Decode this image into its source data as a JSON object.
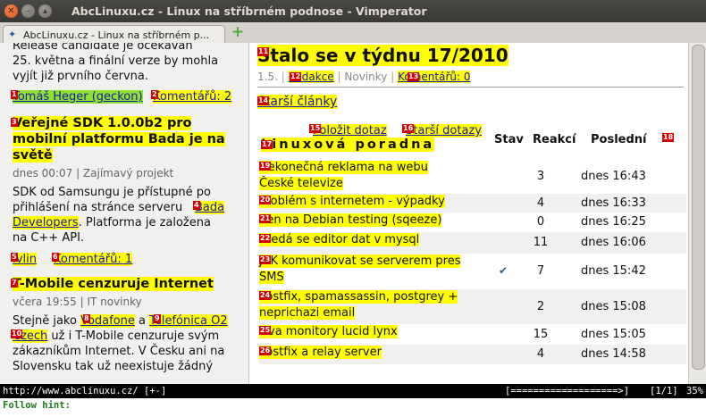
{
  "window": {
    "title": "AbcLinuxu.cz - Linux na stříbrném podnose - Vimperator"
  },
  "tab": {
    "title": "AbcLinuxu.cz - Linux na stříbrném p...",
    "favicon": "abclinuxu-favicon",
    "new_tab": "+"
  },
  "left": {
    "intro_lines": [
      "Release candidate je očekáván",
      "25. května a finální verze by mohla",
      "vyjít již prvního června."
    ],
    "item1": {
      "author_hint": "1",
      "author": "Tomáš Heger (geckon)",
      "comments_hint": "2",
      "comments": "Komentářů: 2"
    },
    "item2": {
      "hint": "3",
      "title_lines": [
        "Veřejné SDK 1.0.0b2 pro",
        "mobilní platformu Bada je na",
        "světě"
      ],
      "meta": "dnes 00:07 | Zajímavý projekt",
      "body1": "SDK od Samsungu je přístupné po",
      "body2": "přihlášení na stránce serveru",
      "link_hint": "4",
      "link_a": "Bada",
      "link_b": "Developers",
      "body3": ". Platforma je založena",
      "body4": "na C++ API.",
      "author_hint": "5",
      "author": "Ivlin",
      "comments_hint": "6",
      "comments": "Komentářů: 1"
    },
    "item3": {
      "hint": "7",
      "title": "T-Mobile cenzuruje Internet",
      "meta": "včera 19:55 | IT novinky",
      "body1a": "Stejně jako ",
      "vodafone_hint": "8",
      "vodafone": "Vodafone",
      "body1b": " a ",
      "tel_hint": "9",
      "tel_a": "Telefónica O2",
      "tel_hint2": "10",
      "tel_b": "Czech",
      "body2b": " už i T-Mobile cenzuruje svým",
      "body3": "zákazníkům Internet. V Česku ani na",
      "body4": "Slovensku tak už neexistuje žádný"
    }
  },
  "right": {
    "title_hint": "11",
    "title": "Stalo se v týdnu 17/2010",
    "meta_date": "1.5.",
    "meta_redakce_hint": "12",
    "meta_redakce": "Redakce",
    "meta_cat": "Novinky",
    "meta_comments_hint": "13",
    "meta_comments": "Komentářů: 0",
    "older_hint": "14",
    "older": "Starší články",
    "ask_hint": "15",
    "ask": "Položit dotaz",
    "older_q_hint": "16",
    "older_q": "Starší dotazy",
    "forum_hint": "17",
    "forum": "Linuxová poradna",
    "col_stav": "Stav",
    "col_reakci": "Reakcí",
    "col_posledni": "Poslední",
    "col_hint": "18",
    "questions": [
      {
        "hint": "19",
        "lines": [
          "Nekonečná reklama na webu",
          "České televize"
        ],
        "replies": "3",
        "last": "dnes 16:43",
        "stav": ""
      },
      {
        "hint": "20",
        "lines": [
          "Problém s internetem - výpadky"
        ],
        "replies": "4",
        "last": "dnes 16:33",
        "stav": ""
      },
      {
        "hint": "21",
        "lines": [
          "Xen na Debian testing (sqeeze)"
        ],
        "replies": "0",
        "last": "dnes 16:25",
        "stav": ""
      },
      {
        "hint": "22",
        "lines": [
          "Hledá se editor dat v mysql"
        ],
        "replies": "11",
        "last": "dnes 16:06",
        "stav": ""
      },
      {
        "hint": "23",
        "lines": [
          "JAK komunikovat se serverem pres",
          "SMS"
        ],
        "replies": "7",
        "last": "dnes 15:42",
        "stav": "✔"
      },
      {
        "hint": "24",
        "lines": [
          "Postfix, spamassassin, postgrey +",
          "neprichazi email"
        ],
        "replies": "2",
        "last": "dnes 15:08",
        "stav": ""
      },
      {
        "hint": "25",
        "lines": [
          "Dva monitory lucid lynx"
        ],
        "replies": "15",
        "last": "dnes 15:05",
        "stav": ""
      },
      {
        "hint": "26",
        "lines": [
          "Postfix a relay server"
        ],
        "replies": "4",
        "last": "dnes 14:58",
        "stav": ""
      }
    ]
  },
  "statusbar": {
    "url": "http://www.abclinuxu.cz/ [+-]",
    "progress": "[===================>]",
    "position": "[1/1]",
    "percent": "35%"
  },
  "cmdline": {
    "text": "Follow hint:"
  }
}
